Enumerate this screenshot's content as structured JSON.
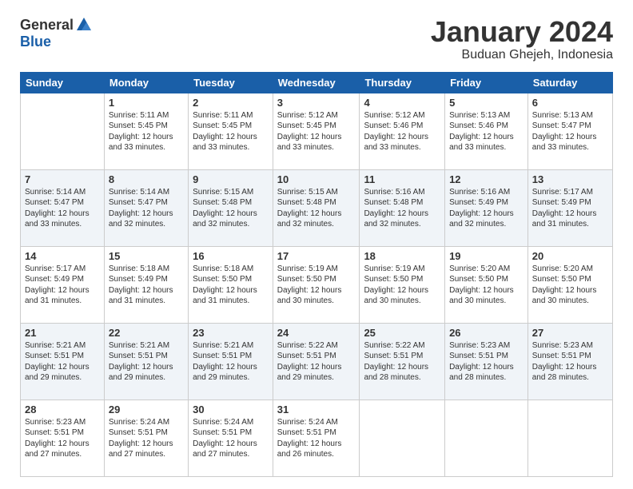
{
  "logo": {
    "general": "General",
    "blue": "Blue"
  },
  "title": "January 2024",
  "subtitle": "Buduan Ghejeh, Indonesia",
  "header_days": [
    "Sunday",
    "Monday",
    "Tuesday",
    "Wednesday",
    "Thursday",
    "Friday",
    "Saturday"
  ],
  "weeks": [
    [
      {
        "day": "",
        "info": ""
      },
      {
        "day": "1",
        "info": "Sunrise: 5:11 AM\nSunset: 5:45 PM\nDaylight: 12 hours\nand 33 minutes."
      },
      {
        "day": "2",
        "info": "Sunrise: 5:11 AM\nSunset: 5:45 PM\nDaylight: 12 hours\nand 33 minutes."
      },
      {
        "day": "3",
        "info": "Sunrise: 5:12 AM\nSunset: 5:45 PM\nDaylight: 12 hours\nand 33 minutes."
      },
      {
        "day": "4",
        "info": "Sunrise: 5:12 AM\nSunset: 5:46 PM\nDaylight: 12 hours\nand 33 minutes."
      },
      {
        "day": "5",
        "info": "Sunrise: 5:13 AM\nSunset: 5:46 PM\nDaylight: 12 hours\nand 33 minutes."
      },
      {
        "day": "6",
        "info": "Sunrise: 5:13 AM\nSunset: 5:47 PM\nDaylight: 12 hours\nand 33 minutes."
      }
    ],
    [
      {
        "day": "7",
        "info": "Sunrise: 5:14 AM\nSunset: 5:47 PM\nDaylight: 12 hours\nand 33 minutes."
      },
      {
        "day": "8",
        "info": "Sunrise: 5:14 AM\nSunset: 5:47 PM\nDaylight: 12 hours\nand 32 minutes."
      },
      {
        "day": "9",
        "info": "Sunrise: 5:15 AM\nSunset: 5:48 PM\nDaylight: 12 hours\nand 32 minutes."
      },
      {
        "day": "10",
        "info": "Sunrise: 5:15 AM\nSunset: 5:48 PM\nDaylight: 12 hours\nand 32 minutes."
      },
      {
        "day": "11",
        "info": "Sunrise: 5:16 AM\nSunset: 5:48 PM\nDaylight: 12 hours\nand 32 minutes."
      },
      {
        "day": "12",
        "info": "Sunrise: 5:16 AM\nSunset: 5:49 PM\nDaylight: 12 hours\nand 32 minutes."
      },
      {
        "day": "13",
        "info": "Sunrise: 5:17 AM\nSunset: 5:49 PM\nDaylight: 12 hours\nand 31 minutes."
      }
    ],
    [
      {
        "day": "14",
        "info": "Sunrise: 5:17 AM\nSunset: 5:49 PM\nDaylight: 12 hours\nand 31 minutes."
      },
      {
        "day": "15",
        "info": "Sunrise: 5:18 AM\nSunset: 5:49 PM\nDaylight: 12 hours\nand 31 minutes."
      },
      {
        "day": "16",
        "info": "Sunrise: 5:18 AM\nSunset: 5:50 PM\nDaylight: 12 hours\nand 31 minutes."
      },
      {
        "day": "17",
        "info": "Sunrise: 5:19 AM\nSunset: 5:50 PM\nDaylight: 12 hours\nand 30 minutes."
      },
      {
        "day": "18",
        "info": "Sunrise: 5:19 AM\nSunset: 5:50 PM\nDaylight: 12 hours\nand 30 minutes."
      },
      {
        "day": "19",
        "info": "Sunrise: 5:20 AM\nSunset: 5:50 PM\nDaylight: 12 hours\nand 30 minutes."
      },
      {
        "day": "20",
        "info": "Sunrise: 5:20 AM\nSunset: 5:50 PM\nDaylight: 12 hours\nand 30 minutes."
      }
    ],
    [
      {
        "day": "21",
        "info": "Sunrise: 5:21 AM\nSunset: 5:51 PM\nDaylight: 12 hours\nand 29 minutes."
      },
      {
        "day": "22",
        "info": "Sunrise: 5:21 AM\nSunset: 5:51 PM\nDaylight: 12 hours\nand 29 minutes."
      },
      {
        "day": "23",
        "info": "Sunrise: 5:21 AM\nSunset: 5:51 PM\nDaylight: 12 hours\nand 29 minutes."
      },
      {
        "day": "24",
        "info": "Sunrise: 5:22 AM\nSunset: 5:51 PM\nDaylight: 12 hours\nand 29 minutes."
      },
      {
        "day": "25",
        "info": "Sunrise: 5:22 AM\nSunset: 5:51 PM\nDaylight: 12 hours\nand 28 minutes."
      },
      {
        "day": "26",
        "info": "Sunrise: 5:23 AM\nSunset: 5:51 PM\nDaylight: 12 hours\nand 28 minutes."
      },
      {
        "day": "27",
        "info": "Sunrise: 5:23 AM\nSunset: 5:51 PM\nDaylight: 12 hours\nand 28 minutes."
      }
    ],
    [
      {
        "day": "28",
        "info": "Sunrise: 5:23 AM\nSunset: 5:51 PM\nDaylight: 12 hours\nand 27 minutes."
      },
      {
        "day": "29",
        "info": "Sunrise: 5:24 AM\nSunset: 5:51 PM\nDaylight: 12 hours\nand 27 minutes."
      },
      {
        "day": "30",
        "info": "Sunrise: 5:24 AM\nSunset: 5:51 PM\nDaylight: 12 hours\nand 27 minutes."
      },
      {
        "day": "31",
        "info": "Sunrise: 5:24 AM\nSunset: 5:51 PM\nDaylight: 12 hours\nand 26 minutes."
      },
      {
        "day": "",
        "info": ""
      },
      {
        "day": "",
        "info": ""
      },
      {
        "day": "",
        "info": ""
      }
    ]
  ]
}
